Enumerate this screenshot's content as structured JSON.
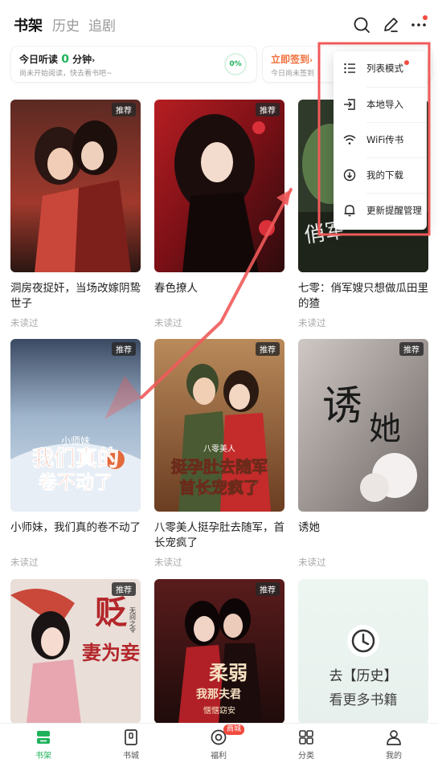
{
  "header": {
    "tabs": [
      {
        "label": "书架",
        "active": true
      },
      {
        "label": "历史",
        "active": false
      },
      {
        "label": "追剧",
        "active": false
      }
    ],
    "icons": [
      "search-icon",
      "edit-icon",
      "more-icon"
    ]
  },
  "stats": {
    "listen": {
      "prefix": "今日听读",
      "value": "0",
      "suffix": "分钟",
      "sub": "尚未开始阅读，快去看书吧~",
      "percent": "0%"
    },
    "checkin": {
      "title": "立即签到",
      "sub": "今日尚未签到"
    }
  },
  "books": [
    {
      "title": "洞房夜捉奸，当场改嫁阴鸷世子",
      "status": "未读过",
      "badge": "推荐"
    },
    {
      "title": "春色撩人",
      "status": "未读过",
      "badge": "推荐"
    },
    {
      "title": "七零：俏军嫂只想做瓜田里的猹",
      "status": "未读过",
      "badge": "推荐"
    },
    {
      "title": "小师妹，我们真的卷不动了",
      "status": "未读过",
      "badge": "推荐"
    },
    {
      "title": "八零美人挺孕肚去随军，首长宠疯了",
      "status": "未读过",
      "badge": "推荐"
    },
    {
      "title": "诱她",
      "status": "未读过",
      "badge": "推荐"
    },
    {
      "badge": "推荐"
    },
    {
      "badge": "推荐"
    }
  ],
  "covers": {
    "c4": {
      "tag": "小师妹",
      "line1": "我们真的",
      "line2": "卷不动了"
    },
    "c5": {
      "tag": "八零美人",
      "line1": "挺孕肚去随军",
      "line2": "首长宠疯了"
    },
    "c6": {
      "line1": "诱",
      "line2": "她"
    },
    "c7": {
      "line1": "贬",
      "line2": "妻为妾",
      "author": "无间之令"
    },
    "c8": {
      "line1": "柔弱",
      "line2": "我那夫君",
      "author": "惬惬窈安"
    }
  },
  "history_card": {
    "line1": "去【历史】",
    "line2": "看更多书籍"
  },
  "menu": {
    "items": [
      {
        "label": "列表模式",
        "icon": "list-icon"
      },
      {
        "label": "本地导入",
        "icon": "import-icon"
      },
      {
        "label": "WiFi传书",
        "icon": "wifi-icon"
      },
      {
        "label": "我的下载",
        "icon": "download-icon"
      },
      {
        "label": "更新提醒管理",
        "icon": "bell-icon"
      }
    ]
  },
  "bottom_nav": {
    "items": [
      {
        "label": "书架",
        "active": true
      },
      {
        "label": "书城",
        "active": false
      },
      {
        "label": "福利",
        "active": false
      },
      {
        "label": "分类",
        "active": false
      },
      {
        "label": "我的",
        "active": false
      }
    ],
    "mall_badge": "商城"
  },
  "colors": {
    "accent": "#1fb25a",
    "badge_red": "#f24b3f",
    "annotation": "#f05a5a"
  }
}
